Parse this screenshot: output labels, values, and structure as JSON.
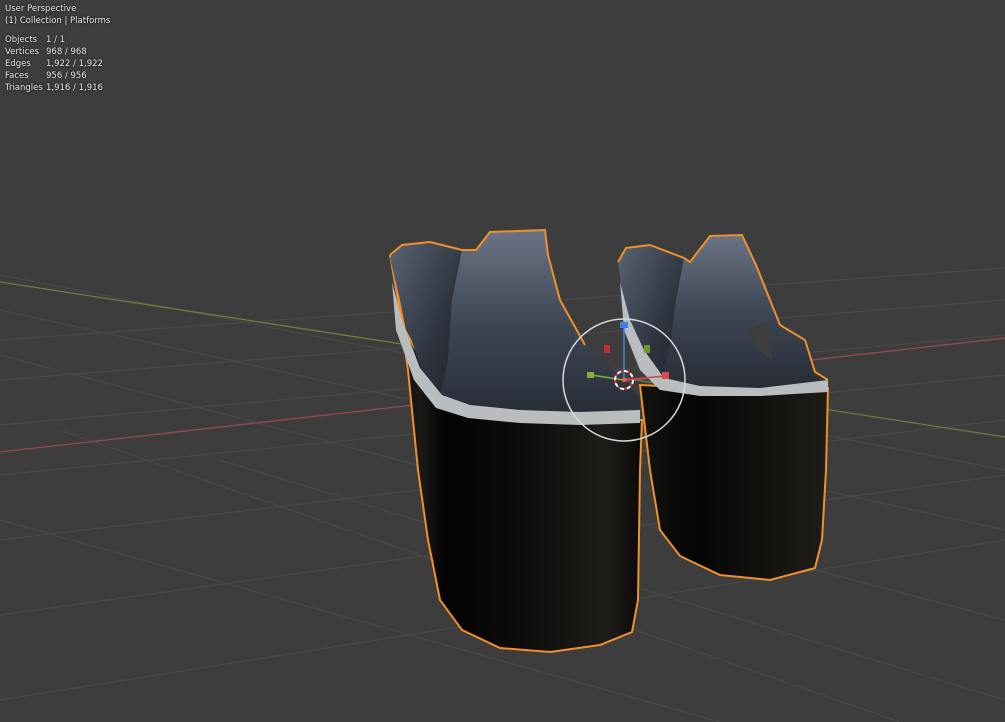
{
  "viewport": {
    "view_name": "User Perspective",
    "collection_line": "(1) Collection | Platforms"
  },
  "stats": [
    {
      "label": "Objects",
      "value": "1 / 1"
    },
    {
      "label": "Vertices",
      "value": "968 / 968"
    },
    {
      "label": "Edges",
      "value": "1,922 / 1,922"
    },
    {
      "label": "Faces",
      "value": "956 / 956"
    },
    {
      "label": "Triangles",
      "value": "1,916 / 1,916"
    }
  ],
  "colors": {
    "background": "#3d3d3d",
    "selection_outline": "#f0902a",
    "x_axis": "#c9474d",
    "y_axis": "#82b13b",
    "z_axis": "#3d80e6",
    "platform_body": "#0b0b0a",
    "insole": "#4a5260"
  },
  "gizmo_icons": [
    "move-gizmo-icon",
    "3d-cursor-icon"
  ]
}
